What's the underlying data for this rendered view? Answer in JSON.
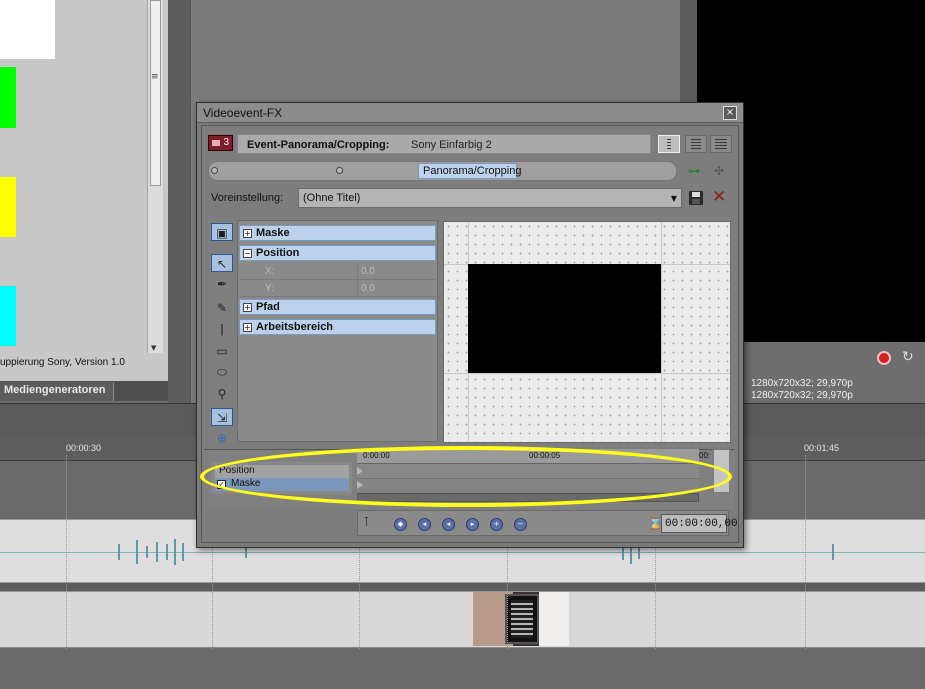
{
  "background": {
    "plugin_description": "uppierung Sony, Version 1.0",
    "tab_media_generators": "Mediengeneratoren",
    "preview_line1": "1280x720x32; 29,970p",
    "preview_line2": "1280x720x32; 29,970p",
    "timeline_marks": [
      "00:00:30",
      "00:01:45"
    ],
    "swatch_colors": [
      "#ffffff",
      "#00ff00",
      "#ffff00",
      "#00ffff"
    ]
  },
  "dialog": {
    "title": "Videoevent-FX",
    "chain_count": "3",
    "event_label": "Event-Panorama/Cropping:",
    "event_name": "Sony Einfarbig 2",
    "chain_plugin": "Panorama/Cropping",
    "preset_label": "Voreinstellung:",
    "preset_value": "(Ohne Titel)",
    "properties": {
      "mask": "Maske",
      "position": "Position",
      "x_label": "X:",
      "x_value": "0,0",
      "y_label": "Y:",
      "y_value": "0,0",
      "path": "Pfad",
      "workspace": "Arbeitsbereich"
    },
    "keyframes": {
      "tracks": [
        "Position",
        "Maske"
      ],
      "mask_checked": true,
      "times": [
        "0:00:00",
        "00:00:05",
        "00:"
      ],
      "current_time": "00:00:00,00"
    }
  },
  "annotation": {
    "highlight_color": "#ffff1a"
  }
}
